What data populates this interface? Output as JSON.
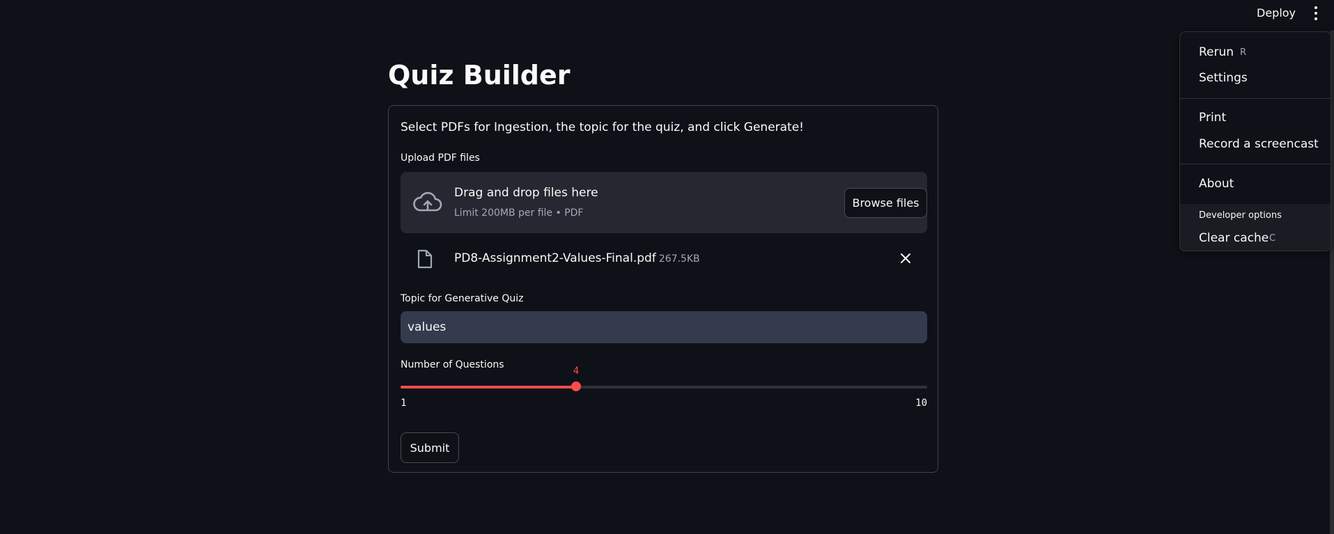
{
  "header": {
    "deploy_label": "Deploy",
    "menu_icon": "kebab-vertical-icon"
  },
  "main": {
    "title": "Quiz Builder",
    "intro": "Select PDFs for Ingestion, the topic for the quiz, and click Generate!",
    "upload": {
      "label": "Upload PDF files",
      "dropzone_title": "Drag and drop files here",
      "dropzone_subtitle": "Limit 200MB per file • PDF",
      "browse_label": "Browse files",
      "cloud_icon": "cloud-upload-icon"
    },
    "file": {
      "name": "PD8-Assignment2-Values-Final.pdf",
      "size": "267.5KB",
      "icon": "file-icon",
      "remove_icon": "close-icon"
    },
    "topic": {
      "label": "Topic for Generative Quiz",
      "value": "values"
    },
    "questions": {
      "label": "Number of Questions",
      "min": 1,
      "max": 10,
      "value": 4,
      "min_label": "1",
      "max_label": "10",
      "value_label": "4",
      "accent_color": "#ff4b4b"
    },
    "submit_label": "Submit"
  },
  "menu": {
    "items": [
      {
        "label": "Rerun",
        "shortcut": "R"
      },
      {
        "label": "Settings",
        "shortcut": ""
      },
      {
        "label": "Print",
        "shortcut": ""
      },
      {
        "label": "Record a screencast",
        "shortcut": ""
      },
      {
        "label": "About",
        "shortcut": ""
      }
    ],
    "developer_label": "Developer options",
    "developer_items": [
      {
        "label": "Clear cache",
        "shortcut": "C"
      }
    ]
  },
  "colors": {
    "background": "#0e1117",
    "accent": "#ff4b4b",
    "input_bg": "#343b4d",
    "dropzone_bg": "#262730"
  }
}
